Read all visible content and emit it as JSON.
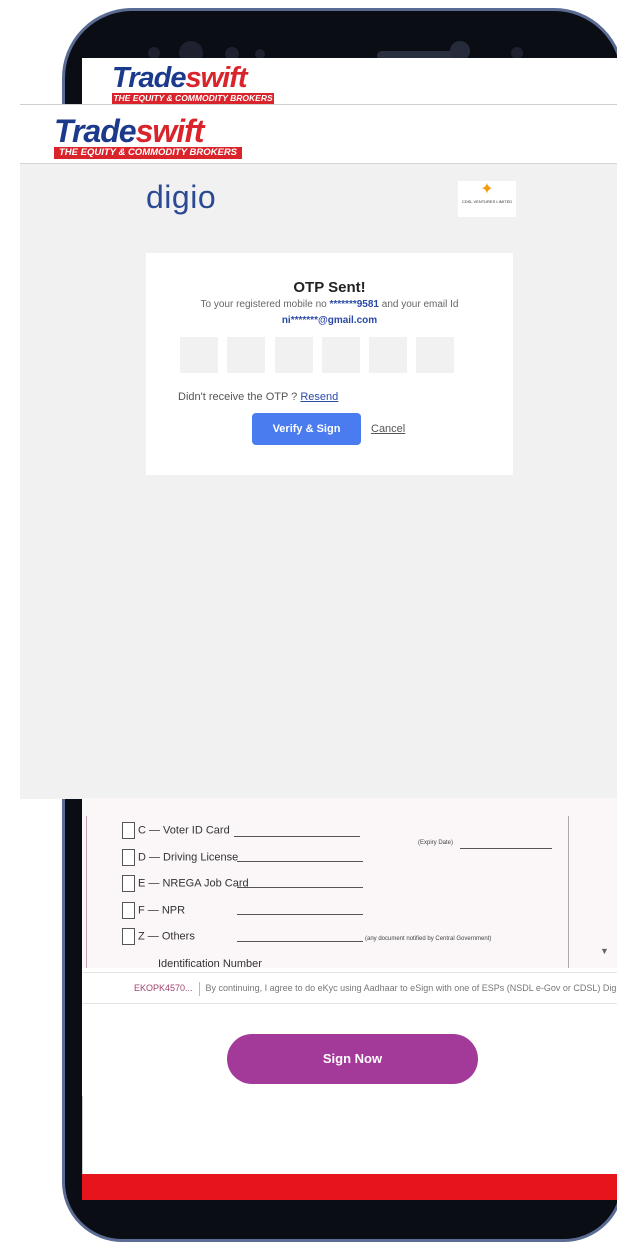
{
  "brand": {
    "name_part1": "Trade",
    "name_part2": "swift",
    "tagline": "THE EQUITY & COMMODITY BROKERS",
    "colors": {
      "blue": "#1c3a8c",
      "red": "#d8242a"
    }
  },
  "web": {
    "provider_logo": "digio",
    "partner_logo_text": "CDSL VENTURES LIMITED",
    "otp": {
      "title": "OTP Sent!",
      "line1_prefix": "To your registered mobile no",
      "mobile_masked": "*******9581",
      "line1_suffix": "and your email Id",
      "email_masked": "ni*******@gmail.com",
      "resend_prompt": "Didn't receive the OTP ?",
      "resend_link": "Resend",
      "verify_button": "Verify & Sign",
      "cancel_link": "Cancel",
      "accent_color": "#4a7cf0"
    }
  },
  "form": {
    "rows": [
      {
        "label": "C — Voter ID Card"
      },
      {
        "label": "D — Driving License"
      },
      {
        "label": "E — NREGA Job Card"
      },
      {
        "label": "F — NPR"
      },
      {
        "label": "Z — Others"
      }
    ],
    "expiry_label": "(Expiry Date)",
    "others_note": "(any document notified by Central Government)",
    "id_number_label": "Identification Number"
  },
  "consent": {
    "code": "EKOPK4570...",
    "text": "By continuing, I agree to do eKyc using Aadhaar to eSign with one of ESPs (NSDL e-Gov or CDSL) Digio is registered as ASP."
  },
  "sign_button": "Sign Now",
  "sign_button_color": "#a33a9a"
}
